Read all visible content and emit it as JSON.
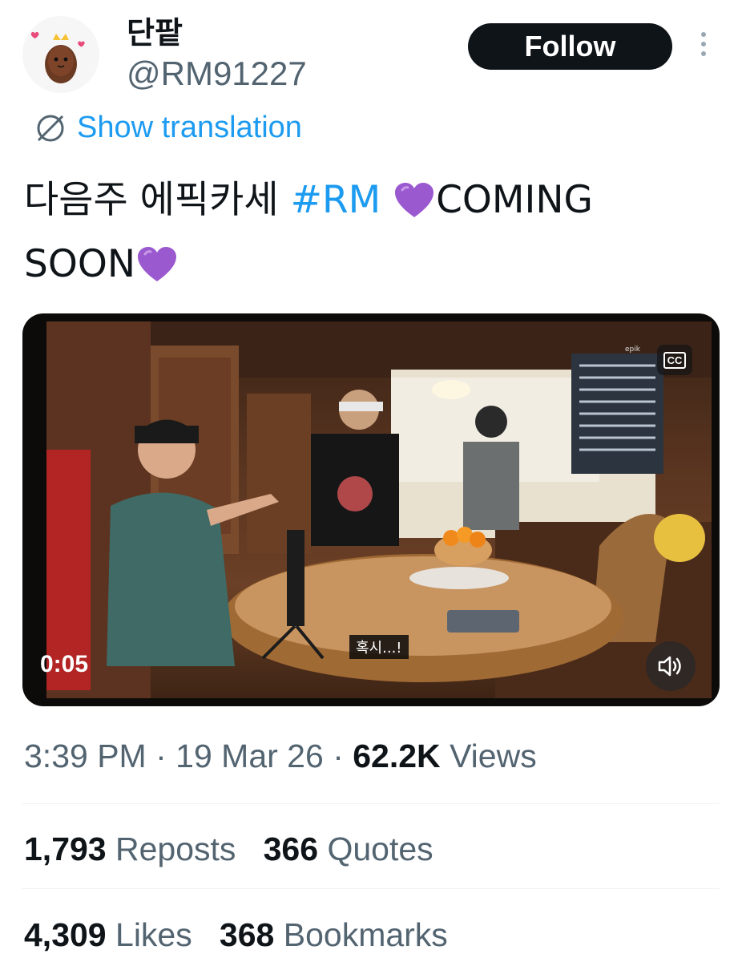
{
  "author": {
    "display_name": "단팥",
    "handle": "@RM91227",
    "avatar_icon": "bean-mascot-avatar-icon"
  },
  "header": {
    "follow_label": "Follow",
    "more_icon": "more-vertical-icon"
  },
  "translation": {
    "label": "Show translation",
    "icon": "globe-icon"
  },
  "tweet": {
    "text_before": "다음주 에픽카세 ",
    "hashtag": "#RM",
    "text_after": "COMING SOON",
    "emoji": "purple-heart"
  },
  "media": {
    "duration": "0:05",
    "subtitle": "혹시...!",
    "cc_label": "CC",
    "mute_icon": "speaker-icon"
  },
  "meta": {
    "time": "3:39 PM",
    "sep": "·",
    "date": "19 Mar 26",
    "views_count": "62.2K",
    "views_label": "Views"
  },
  "stats": {
    "reposts_count": "1,793",
    "reposts_label": "Reposts",
    "quotes_count": "366",
    "quotes_label": "Quotes",
    "likes_count": "4,309",
    "likes_label": "Likes",
    "bookmarks_count": "368",
    "bookmarks_label": "Bookmarks"
  },
  "colors": {
    "link": "#1d9bf0",
    "text": "#0f1419",
    "secondary": "#536471",
    "follow_bg": "#0f1419",
    "heart": "#9b59d0"
  }
}
